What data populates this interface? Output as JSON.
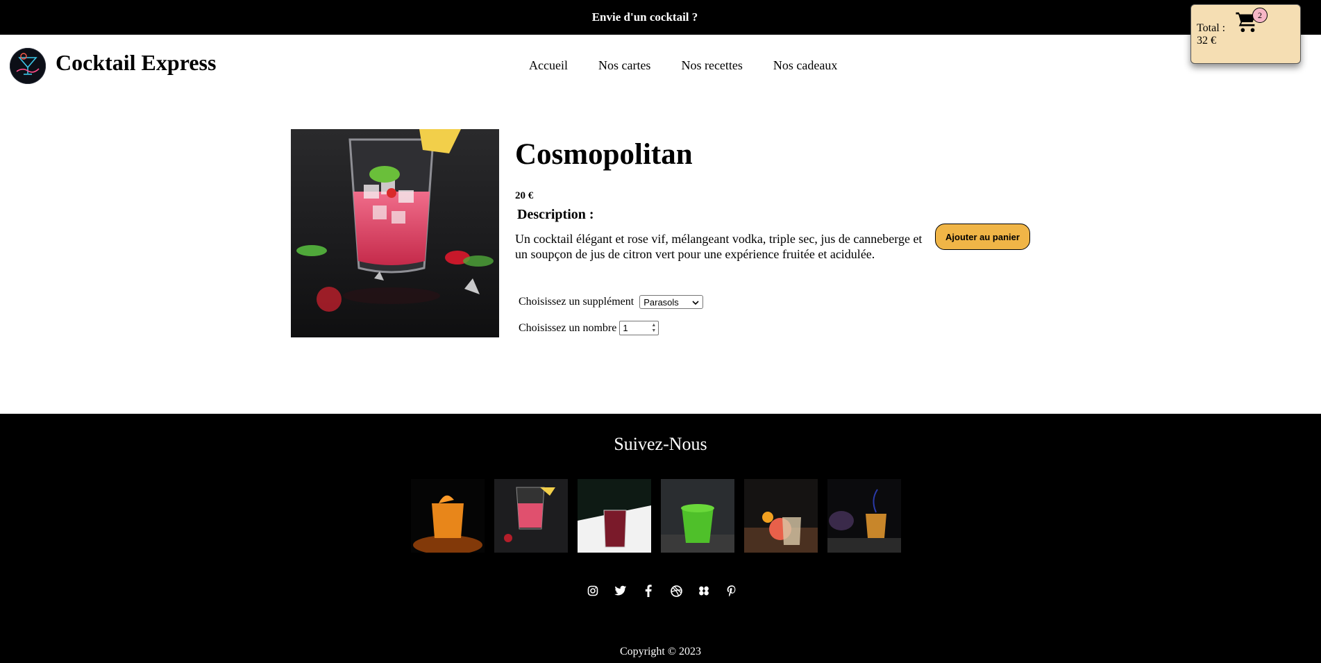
{
  "topbar": {
    "text": "Envie d'un cocktail ?"
  },
  "header": {
    "brand": "Cocktail Express",
    "logo_icon": "cocktail-neon-logo",
    "nav": [
      "Accueil",
      "Nos cartes",
      "Nos recettes",
      "Nos cadeaux"
    ]
  },
  "cart": {
    "total_label": "Total :",
    "total_value": "32 €",
    "count": "2",
    "icon": "shopping-cart-icon",
    "background": "#f5deb3"
  },
  "product": {
    "name": "Cosmopolitan",
    "price": "20 €",
    "description_title": "Description :",
    "description": "Un cocktail élégant et rose vif, mélangeant vodka, triple sec, jus de canneberge et un soupçon de jus de citron vert pour une expérience fruitée et acidulée.",
    "supplement_label": "Choisissez un supplément",
    "supplement_value": "Parasols",
    "quantity_label": "Choisissez un nombre",
    "quantity_value": "1",
    "add_button": "Ajouter au panier",
    "button_color": "#f0b547"
  },
  "footer": {
    "title": "Suivez-Nous",
    "gallery": [
      "orange-cocktail",
      "pink-cocktail",
      "red-cocktail",
      "green-cocktail",
      "grapefruit-cocktail",
      "smoky-cocktail"
    ],
    "socials": [
      "instagram-icon",
      "twitter-icon",
      "facebook-icon",
      "dribbble-icon",
      "dropbox-icon",
      "pinterest-icon"
    ],
    "copyright": "Copyright © 2023"
  }
}
